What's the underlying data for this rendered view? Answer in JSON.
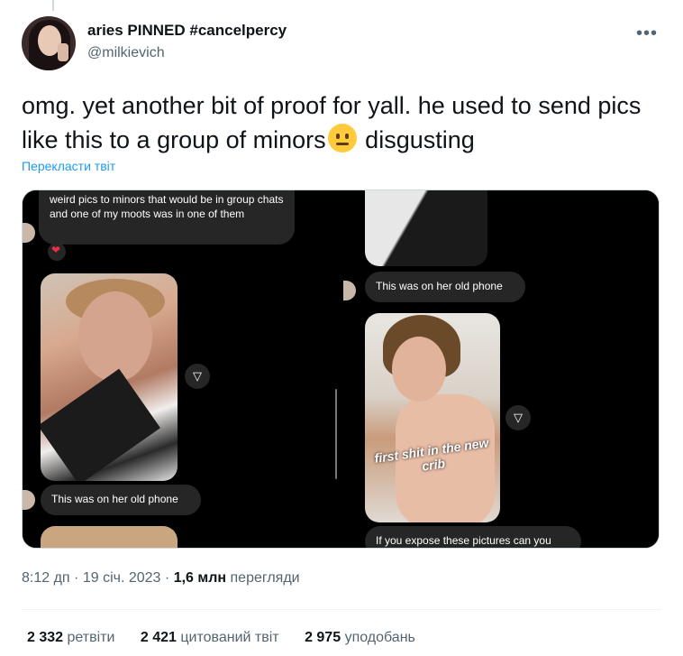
{
  "author": {
    "display_name": "aries PINNED #cancelpercy",
    "handle": "@milkievich"
  },
  "more_icon": "more-dots-icon",
  "tweet": {
    "text_before_emoji": "omg. yet another bit of proof for yall. he used to send pics like this to a group of minors",
    "emoji": "neutral-face-emoji",
    "text_after_emoji": " disgusting",
    "translate_label": "Перекласти твіт"
  },
  "media": {
    "left": {
      "message_top": "weird pics to minors that would be in group chats and one of my moots was in one of them",
      "reaction": "heart-reaction",
      "message_bottom": "This was on her old phone"
    },
    "right": {
      "message_top": "This was on her old phone",
      "photo_caption": "first shit in the new crib",
      "message_bottom": "If you expose these pictures can you"
    }
  },
  "meta": {
    "time": "8:12 дп",
    "separator": "·",
    "date": "19 січ. 2023",
    "views_count": "1,6 млн",
    "views_label": "перегляди"
  },
  "stats": {
    "retweets_count": "2 332",
    "retweets_label": "ретвіти",
    "quotes_count": "2 421",
    "quotes_label": "цитований твіт",
    "likes_count": "2 975",
    "likes_label": "уподобань"
  },
  "colors": {
    "link": "#1d9bf0",
    "secondary_text": "#536471",
    "primary_text": "#0f1419"
  }
}
